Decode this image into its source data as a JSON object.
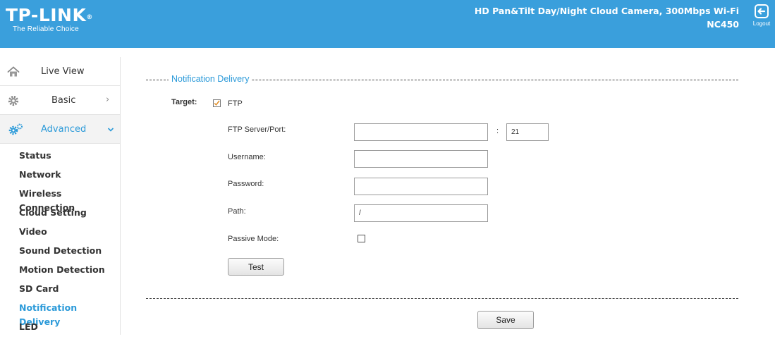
{
  "header": {
    "logo": "TP-LINK",
    "logo_reg": "®",
    "tagline": "The Reliable Choice",
    "product_line1": "HD Pan&Tilt Day/Night Cloud Camera, 300Mbps Wi-Fi",
    "product_line2": "NC450",
    "logout_label": "Logout",
    "color": "#3a9fdc"
  },
  "sidebar": {
    "main_items": [
      {
        "label": "Live View",
        "icon": "home-icon"
      },
      {
        "label": "Basic",
        "icon": "gear-icon",
        "chevron": "›"
      },
      {
        "label": "Advanced",
        "icon": "gears-icon",
        "chevron": "⌄",
        "active": true
      }
    ],
    "sub_items": [
      "Status",
      "Network",
      "Wireless Connection",
      "Cloud Setting",
      "Video",
      "Sound Detection",
      "Motion Detection",
      "SD Card",
      "Notification Delivery",
      "LED"
    ],
    "active_sub": "Notification Delivery",
    "accent": "#2b9ad9"
  },
  "form": {
    "legend": "Notification Delivery",
    "target_label": "Target:",
    "ftp_label": "FTP",
    "ftp_checked": true,
    "server_label": "FTP Server/Port:",
    "server_value": "",
    "port_separator": ":",
    "port_value": "21",
    "username_label": "Username:",
    "username_value": "",
    "password_label": "Password:",
    "password_value": "",
    "path_label": "Path:",
    "path_value": "/",
    "passive_label": "Passive Mode:",
    "passive_checked": false,
    "test_button": "Test",
    "save_button": "Save"
  }
}
